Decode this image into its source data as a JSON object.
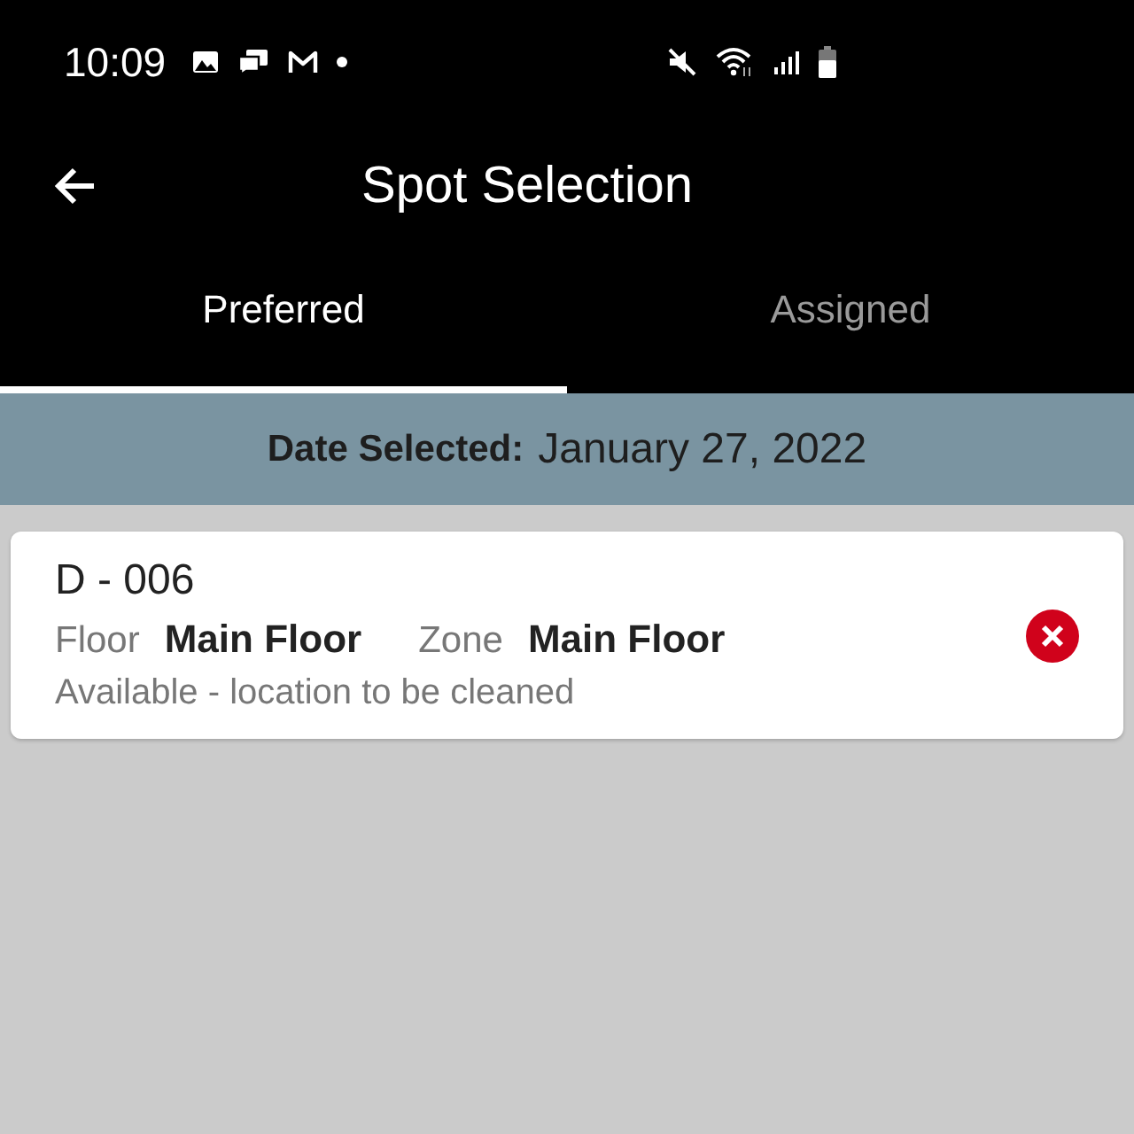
{
  "status_bar": {
    "time": "10:09"
  },
  "app_bar": {
    "title": "Spot Selection"
  },
  "tabs": [
    {
      "label": "Preferred",
      "selected": true
    },
    {
      "label": "Assigned",
      "selected": false
    }
  ],
  "date_banner": {
    "label": "Date Selected:",
    "value": "January 27, 2022"
  },
  "spots": [
    {
      "code": "D - 006",
      "floor_label": "Floor",
      "floor": "Main Floor",
      "zone_label": "Zone",
      "zone": "Main Floor",
      "status": "Available - location to be cleaned"
    }
  ]
}
